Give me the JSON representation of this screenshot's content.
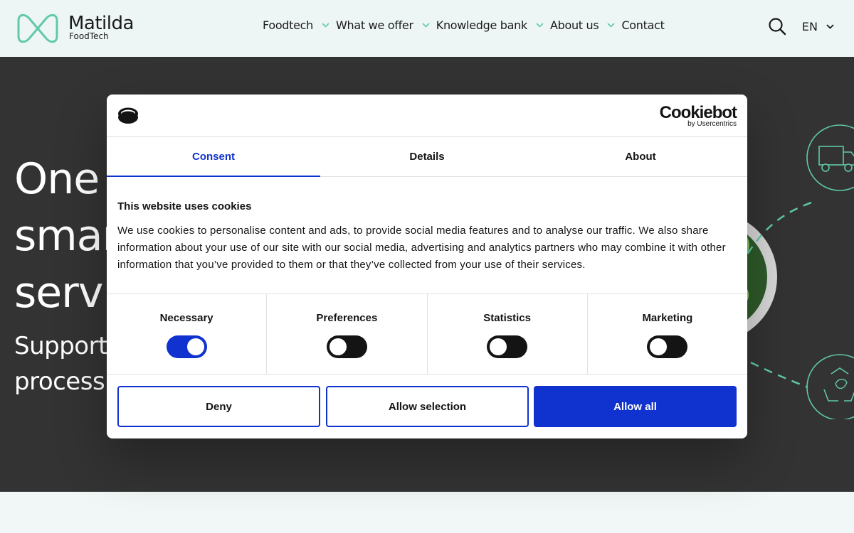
{
  "header": {
    "logo_name": "Matilda",
    "logo_sub": "FoodTech",
    "nav": [
      {
        "label": "Foodtech",
        "has_dropdown": true
      },
      {
        "label": "What we offer",
        "has_dropdown": true
      },
      {
        "label": "Knowledge bank",
        "has_dropdown": true
      },
      {
        "label": "About us",
        "has_dropdown": true
      },
      {
        "label": "Contact",
        "has_dropdown": false
      }
    ],
    "language": "EN"
  },
  "hero": {
    "heading_lines": [
      "One",
      "smar",
      "servi"
    ],
    "sub_lines": [
      "Support",
      "process."
    ]
  },
  "cookie_dialog": {
    "brand_name": "Cookiebot",
    "brand_by": "by Usercentrics",
    "tabs": [
      {
        "label": "Consent",
        "active": true
      },
      {
        "label": "Details",
        "active": false
      },
      {
        "label": "About",
        "active": false
      }
    ],
    "heading": "This website uses cookies",
    "text": "We use cookies to personalise content and ads, to provide social media features and to analyse our traffic. We also share information about your use of our site with our social media, advertising and analytics partners who may combine it with other information that you’ve provided to them or that they’ve collected from your use of their services.",
    "categories": [
      {
        "label": "Necessary",
        "checked": true
      },
      {
        "label": "Preferences",
        "checked": false
      },
      {
        "label": "Statistics",
        "checked": false
      },
      {
        "label": "Marketing",
        "checked": false
      }
    ],
    "buttons": {
      "deny": "Deny",
      "allow_selection": "Allow selection",
      "allow_all": "Allow all"
    }
  },
  "colors": {
    "accent_green": "#5fc9a8",
    "cookie_blue": "#1032cf",
    "hero_bg": "#333333",
    "header_bg": "#eef6f5"
  },
  "icons": {
    "logo": "infinity-loop-icon",
    "search": "search-icon",
    "dropdown": "chevron-down-icon",
    "cookiebot_mark": "cookie-icon",
    "truck": "truck-icon",
    "recycle": "recycle-icon"
  }
}
